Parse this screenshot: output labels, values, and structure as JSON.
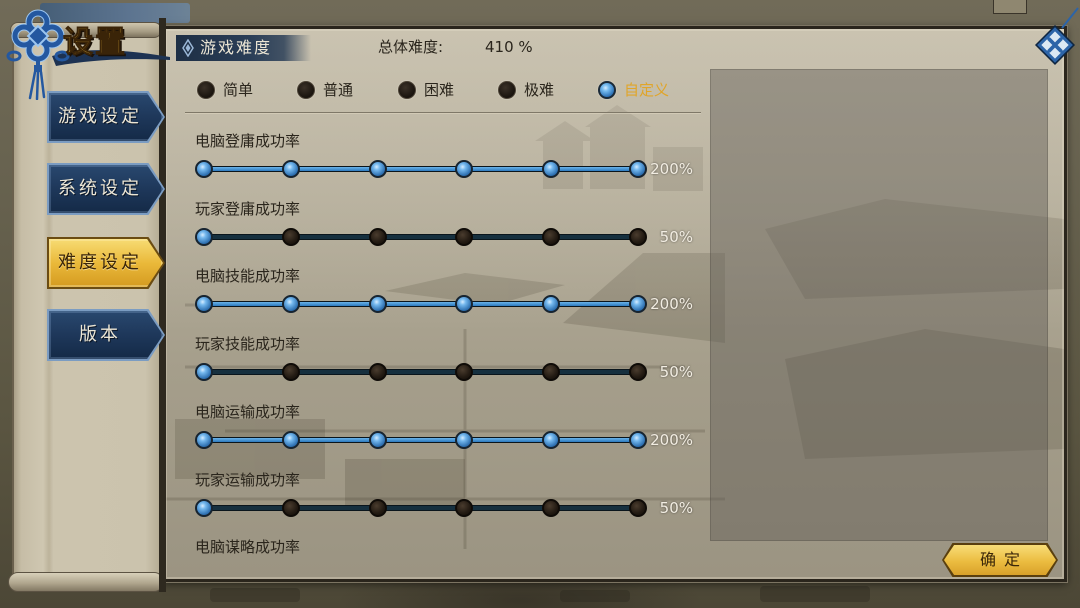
{
  "window": {
    "title": "设置"
  },
  "sidebar": {
    "tabs": [
      {
        "label": "游戏设定",
        "active": false
      },
      {
        "label": "系统设定",
        "active": false
      },
      {
        "label": "难度设定",
        "active": true
      },
      {
        "label": "版本",
        "active": false
      }
    ]
  },
  "section": {
    "title": "游戏难度",
    "overall_label": "总体难度:",
    "overall_value": "410 %"
  },
  "difficulty_options": [
    {
      "label": "简单",
      "selected": false
    },
    {
      "label": "普通",
      "selected": false
    },
    {
      "label": "困难",
      "selected": false
    },
    {
      "label": "极难",
      "selected": false
    },
    {
      "label": "自定义",
      "selected": true
    }
  ],
  "sliders": [
    {
      "label": "电脑登庸成功率",
      "value": "200%",
      "level": 5,
      "levels": 6
    },
    {
      "label": "玩家登庸成功率",
      "value": "50%",
      "level": 0,
      "levels": 6
    },
    {
      "label": "电脑技能成功率",
      "value": "200%",
      "level": 5,
      "levels": 6
    },
    {
      "label": "玩家技能成功率",
      "value": "50%",
      "level": 0,
      "levels": 6
    },
    {
      "label": "电脑运输成功率",
      "value": "200%",
      "level": 5,
      "levels": 6
    },
    {
      "label": "玩家运输成功率",
      "value": "50%",
      "level": 0,
      "levels": 6
    },
    {
      "label": "电脑谋略成功率"
    }
  ],
  "footer": {
    "confirm_label": "确定"
  },
  "icons": {
    "ornament": "chinese-knot-icon",
    "section": "diamond-icon",
    "close": "close-icon"
  },
  "colors": {
    "accent_gold": "#e6b53a",
    "selected_label": "#e0a52a",
    "active_blue": "#3a8fd4",
    "tab_navy": "#1d3658",
    "text_dark": "#2a251c"
  }
}
